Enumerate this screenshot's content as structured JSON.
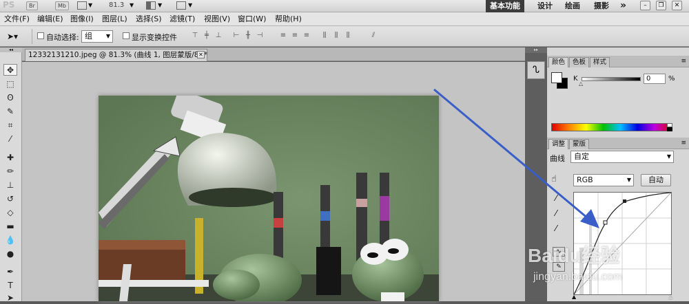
{
  "appbar": {
    "logo": "PS",
    "br": "Br",
    "mb": "Mb",
    "zoom": "81.3",
    "workspaces": [
      "基本功能",
      "设计",
      "绘画",
      "摄影"
    ],
    "more": "»"
  },
  "menu": [
    "文件(F)",
    "编辑(E)",
    "图像(I)",
    "图层(L)",
    "选择(S)",
    "滤镜(T)",
    "视图(V)",
    "窗口(W)",
    "帮助(H)"
  ],
  "options": {
    "auto_select_label": "自动选择:",
    "auto_select_value": "组",
    "show_transform_label": "显示变换控件"
  },
  "document": {
    "tab_title": "12332131210.jpeg @ 81.3% (曲线 1, 图层蒙版/8) *"
  },
  "color_panel": {
    "tabs": [
      "颜色",
      "色板",
      "样式"
    ],
    "channel": "K",
    "value": "0",
    "unit": "%"
  },
  "adjust_panel": {
    "tabs": [
      "调整",
      "蒙版"
    ],
    "preset_label": "曲线",
    "preset_value": "自定",
    "channel_value": "RGB",
    "auto_label": "自动"
  },
  "watermark": {
    "brand": "Baidu经验",
    "url": "jingyan.baidu.com"
  },
  "colors": {
    "annotation_arrow": "#3a5ec8",
    "wall": "#6e8862"
  }
}
